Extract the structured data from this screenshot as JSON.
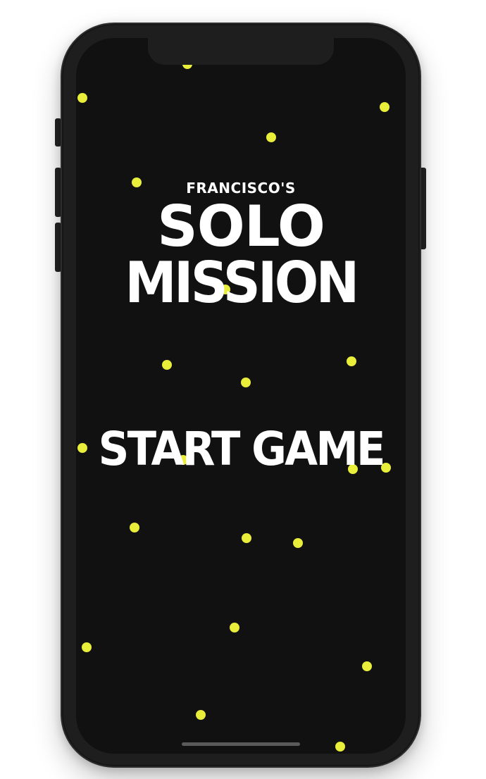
{
  "game": {
    "subtitle": "FRANCISCO'S",
    "title_line_1": "SOLO",
    "title_line_2": "MISSION",
    "start_label": "START GAME"
  },
  "colors": {
    "background": "#111111",
    "star": "#e8ee3a",
    "text": "#ffffff",
    "device_frame": "#1e1e1e"
  },
  "icons": {
    "star": "yellow-dot"
  }
}
